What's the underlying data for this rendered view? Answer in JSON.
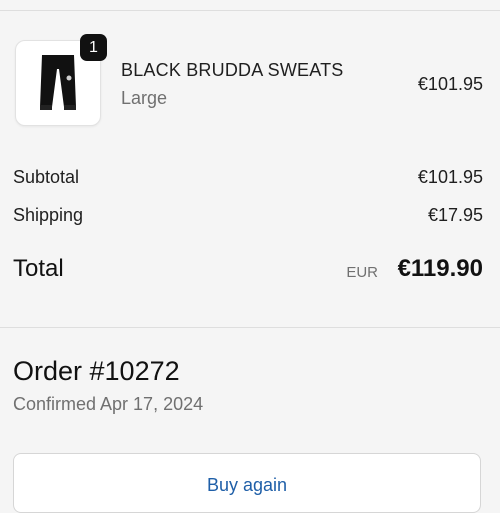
{
  "line_item": {
    "quantity": "1",
    "name": "BLACK BRUDDA SWEATS",
    "variant": "Large",
    "price": "€101.95",
    "image_icon": "black-sweatpants-image"
  },
  "summary": {
    "subtotal_label": "Subtotal",
    "subtotal_value": "€101.95",
    "shipping_label": "Shipping",
    "shipping_value": "€17.95",
    "total_label": "Total",
    "total_currency": "EUR",
    "total_value": "€119.90"
  },
  "order": {
    "number": "Order #10272",
    "confirmed": "Confirmed Apr 17, 2024"
  },
  "actions": {
    "buy_again_label": "Buy again"
  },
  "colors": {
    "background": "#f5f5f5",
    "link_blue": "#1f5fa8",
    "badge": "#111111"
  }
}
